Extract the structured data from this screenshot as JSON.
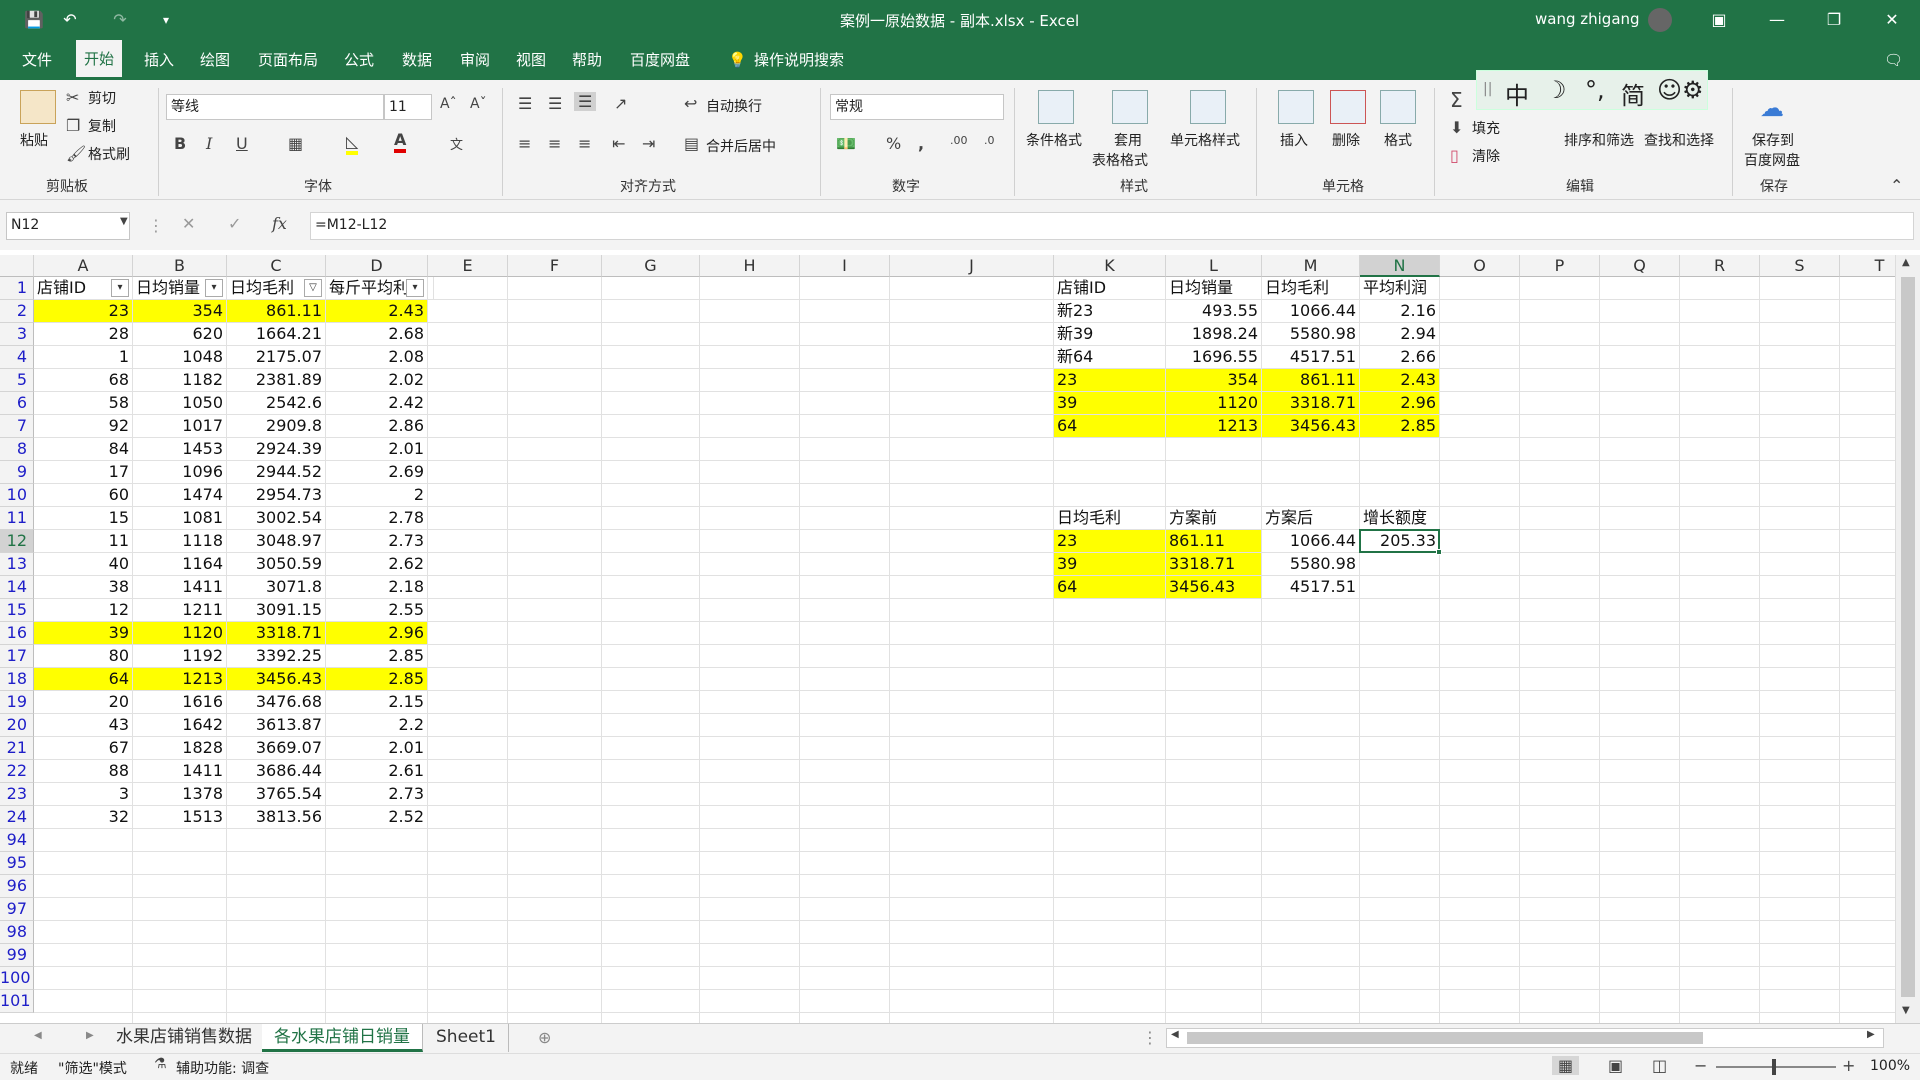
{
  "window": {
    "title": "案例一原始数据 - 副本.xlsx  -  Excel",
    "user": "wang zhigang"
  },
  "ribbon_tabs": [
    "文件",
    "开始",
    "插入",
    "绘图",
    "页面布局",
    "公式",
    "数据",
    "审阅",
    "视图",
    "帮助",
    "百度网盘"
  ],
  "tell_me": "操作说明搜索",
  "clipboard": {
    "paste": "粘贴",
    "cut": "剪切",
    "copy": "复制",
    "format_painter": "格式刷",
    "group": "剪贴板"
  },
  "font": {
    "name": "等线",
    "size": "11",
    "bold": "B",
    "italic": "I",
    "underline": "U",
    "group": "字体"
  },
  "alignment": {
    "wrap": "自动换行",
    "merge": "合并后居中",
    "group": "对齐方式"
  },
  "number": {
    "format": "常规",
    "percent": "%",
    "comma": ",",
    "group": "数字"
  },
  "styles": {
    "conditional": "条件格式",
    "table1": "套用",
    "table2": "表格格式",
    "cell_styles": "单元格样式",
    "group": "样式"
  },
  "cells": {
    "insert": "插入",
    "delete": "删除",
    "format": "格式",
    "group": "单元格"
  },
  "editing": {
    "fill": "填充",
    "clear": "清除",
    "sort": "排序和筛选",
    "find": "查找和选择",
    "group": "编辑"
  },
  "save_group": {
    "save1": "保存到",
    "save2": "百度网盘",
    "group": "保存"
  },
  "ime": {
    "c1": "中",
    "c2": "简"
  },
  "formula_bar": {
    "name_box": "N12",
    "fx": "fx",
    "formula": "=M12-L12"
  },
  "columns": [
    "A",
    "B",
    "C",
    "D",
    "E",
    "F",
    "G",
    "H",
    "I",
    "J",
    "K",
    "L",
    "M",
    "N",
    "O",
    "P",
    "Q",
    "R",
    "S",
    "T"
  ],
  "row_numbers": [
    "1",
    "2",
    "3",
    "4",
    "5",
    "6",
    "7",
    "8",
    "9",
    "10",
    "11",
    "12",
    "13",
    "14",
    "15",
    "16",
    "17",
    "18",
    "19",
    "20",
    "21",
    "22",
    "23",
    "24",
    "94",
    "95",
    "96",
    "97",
    "98",
    "99",
    "100",
    "101"
  ],
  "left_table": {
    "headers": [
      "店铺ID",
      "日均销量",
      "日均毛利",
      "每斤平均利润"
    ],
    "rows": [
      [
        "23",
        "354",
        "861.11",
        "2.43"
      ],
      [
        "28",
        "620",
        "1664.21",
        "2.68"
      ],
      [
        "1",
        "1048",
        "2175.07",
        "2.08"
      ],
      [
        "68",
        "1182",
        "2381.89",
        "2.02"
      ],
      [
        "58",
        "1050",
        "2542.6",
        "2.42"
      ],
      [
        "92",
        "1017",
        "2909.8",
        "2.86"
      ],
      [
        "84",
        "1453",
        "2924.39",
        "2.01"
      ],
      [
        "17",
        "1096",
        "2944.52",
        "2.69"
      ],
      [
        "60",
        "1474",
        "2954.73",
        "2"
      ],
      [
        "15",
        "1081",
        "3002.54",
        "2.78"
      ],
      [
        "11",
        "1118",
        "3048.97",
        "2.73"
      ],
      [
        "40",
        "1164",
        "3050.59",
        "2.62"
      ],
      [
        "38",
        "1411",
        "3071.8",
        "2.18"
      ],
      [
        "12",
        "1211",
        "3091.15",
        "2.55"
      ],
      [
        "39",
        "1120",
        "3318.71",
        "2.96"
      ],
      [
        "80",
        "1192",
        "3392.25",
        "2.85"
      ],
      [
        "64",
        "1213",
        "3456.43",
        "2.85"
      ],
      [
        "20",
        "1616",
        "3476.68",
        "2.15"
      ],
      [
        "43",
        "1642",
        "3613.87",
        "2.2"
      ],
      [
        "67",
        "1828",
        "3669.07",
        "2.01"
      ],
      [
        "88",
        "1411",
        "3686.44",
        "2.61"
      ],
      [
        "3",
        "1378",
        "3765.54",
        "2.73"
      ],
      [
        "32",
        "1513",
        "3813.56",
        "2.52"
      ]
    ]
  },
  "right_table1": {
    "headers": [
      "店铺ID",
      "日均销量",
      "日均毛利",
      "平均利润"
    ],
    "rows": [
      [
        "新23",
        "493.55",
        "1066.44",
        "2.16"
      ],
      [
        "新39",
        "1898.24",
        "5580.98",
        "2.94"
      ],
      [
        "新64",
        "1696.55",
        "4517.51",
        "2.66"
      ],
      [
        "23",
        "354",
        "861.11",
        "2.43"
      ],
      [
        "39",
        "1120",
        "3318.71",
        "2.96"
      ],
      [
        "64",
        "1213",
        "3456.43",
        "2.85"
      ]
    ]
  },
  "right_table2": {
    "headers": [
      "日均毛利",
      "方案前",
      "方案后",
      "增长额度"
    ],
    "rows": [
      [
        "23",
        "861.11",
        "1066.44",
        "205.33"
      ],
      [
        "39",
        "3318.71",
        "5580.98",
        ""
      ],
      [
        "64",
        "3456.43",
        "4517.51",
        ""
      ]
    ]
  },
  "sheets": [
    "水果店铺销售数据",
    "各水果店铺日销量",
    "Sheet1"
  ],
  "status": {
    "ready": "就绪",
    "filter_mode": "\"筛选\"模式",
    "accessibility": "辅助功能: 调查",
    "zoom": "100%"
  }
}
